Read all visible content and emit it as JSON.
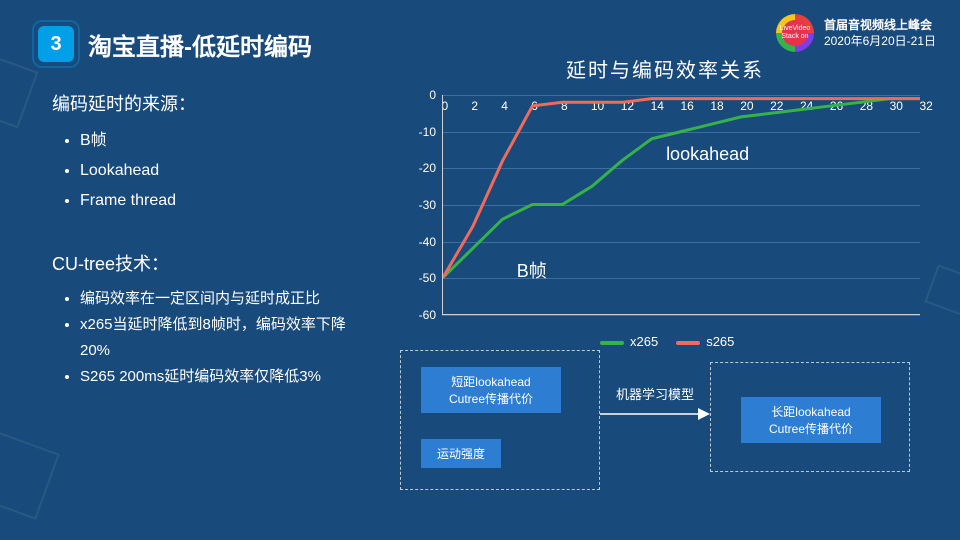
{
  "header": {
    "index": "3",
    "title": "淘宝直播-低延时编码"
  },
  "meta": {
    "line1": "首届音视频线上峰会",
    "line2": "2020年6月20日-21日",
    "logo_text": "LiveVideo Stack on"
  },
  "left": {
    "sec1_head": "编码延时的来源：",
    "sec1_items": [
      "B帧",
      "Lookahead",
      "Frame thread"
    ],
    "sec2_head": "CU-tree技术：",
    "sec2_items": [
      "编码效率在一定区间内与延时成正比",
      "x265当延时降低到8帧时，编码效率下降20%",
      "S265 200ms延时编码效率仅降低3%"
    ]
  },
  "chart_title": "延时与编码效率关系",
  "legend": {
    "s1": "x265",
    "s2": "s265"
  },
  "annotations": {
    "a1": "lookahead",
    "a2": "B帧"
  },
  "diagram": {
    "box1a": "短距lookahead\nCutree传播代价",
    "box1b": "运动强度",
    "arrow_label": "机器学习模型",
    "box2": "长距lookahead\nCutree传播代价"
  },
  "chart_data": {
    "type": "line",
    "title": "延时与编码效率关系",
    "xlabel": "",
    "ylabel": "",
    "xlim": [
      0,
      32
    ],
    "ylim": [
      -60,
      0
    ],
    "x_ticks": [
      0,
      2,
      4,
      6,
      8,
      10,
      12,
      14,
      16,
      18,
      20,
      22,
      24,
      26,
      28,
      30,
      32
    ],
    "y_ticks": [
      0,
      -10,
      -20,
      -30,
      -40,
      -50,
      -60
    ],
    "x": [
      0,
      2,
      4,
      6,
      8,
      10,
      12,
      14,
      16,
      18,
      20,
      22,
      24,
      26,
      28,
      30,
      32
    ],
    "series": [
      {
        "name": "x265",
        "color": "#36b24a",
        "values": [
          -50,
          -42,
          -34,
          -30,
          -30,
          -25,
          -18,
          -12,
          -10,
          -8,
          -6,
          -5,
          -4,
          -3,
          -2,
          -1,
          -1
        ]
      },
      {
        "name": "s265",
        "color": "#f26a5a",
        "values": [
          -50,
          -36,
          -18,
          -3,
          -2,
          -2,
          -2,
          -1,
          -1,
          -1,
          -1,
          -1,
          -1,
          -1,
          -1,
          -1,
          -1
        ]
      }
    ],
    "annotations": [
      {
        "text": "lookahead",
        "x": 15,
        "y": -16
      },
      {
        "text": "B帧",
        "x": 5,
        "y": -47
      }
    ],
    "legend_position": "bottom"
  }
}
